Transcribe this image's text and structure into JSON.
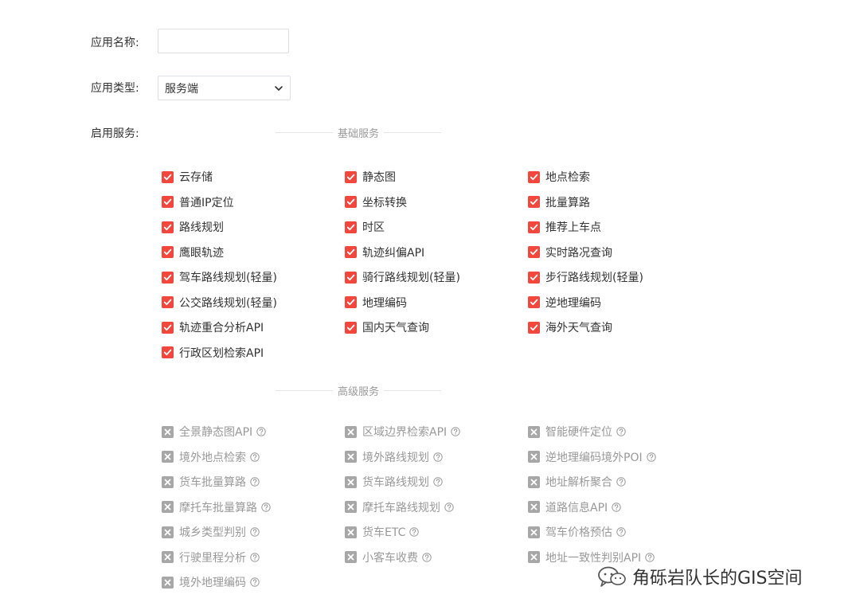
{
  "form": {
    "name_label": "应用名称:",
    "name_value": "",
    "type_label": "应用类型:",
    "type_value": "服务端",
    "services_label": "启用服务:"
  },
  "basic": {
    "title": "基础服务",
    "items": [
      [
        "云存储",
        "静态图",
        "地点检索"
      ],
      [
        "普通IP定位",
        "坐标转换",
        "批量算路"
      ],
      [
        "路线规划",
        "时区",
        "推荐上车点"
      ],
      [
        "鹰眼轨迹",
        "轨迹纠偏API",
        "实时路况查询"
      ],
      [
        "驾车路线规划(轻量)",
        "骑行路线规划(轻量)",
        "步行路线规划(轻量)"
      ],
      [
        "公交路线规划(轻量)",
        "地理编码",
        "逆地理编码"
      ],
      [
        "轨迹重合分析API",
        "国内天气查询",
        "海外天气查询"
      ],
      [
        "行政区划检索API"
      ]
    ]
  },
  "advanced": {
    "title": "高级服务",
    "items": [
      [
        "全景静态图API",
        "区域边界检索API",
        "智能硬件定位"
      ],
      [
        "境外地点检索",
        "境外路线规划",
        "逆地理编码境外POI"
      ],
      [
        "货车批量算路",
        "货车路线规划",
        "地址解析聚合"
      ],
      [
        "摩托车批量算路",
        "摩托车路线规划",
        "道路信息API"
      ],
      [
        "城乡类型判别",
        "货车ETC",
        "驾车价格预估"
      ],
      [
        "行驶里程分析",
        "小客车收费",
        "地址一致性判别API"
      ],
      [
        "境外地理编码"
      ]
    ]
  },
  "colors": {
    "checked": "#f2473c",
    "disabled": "#a7a7a7"
  },
  "watermark": {
    "text": "角砾岩队长的GIS空间"
  }
}
